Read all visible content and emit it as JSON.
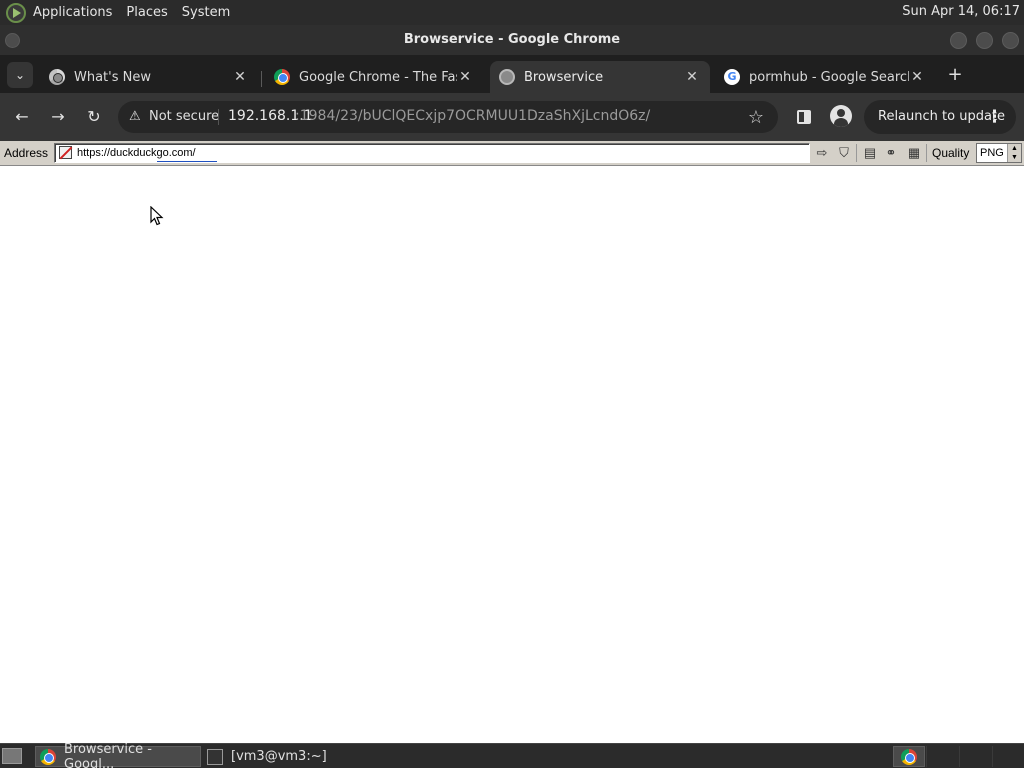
{
  "top_panel": {
    "menus": [
      "Applications",
      "Places",
      "System"
    ],
    "clock": "Sun Apr 14, 06:17"
  },
  "window": {
    "title": "Browservice - Google Chrome"
  },
  "tabs": [
    {
      "title": "What's New",
      "icon": "chrome-mono-icon",
      "active": false
    },
    {
      "title": "Google Chrome - The Fast",
      "icon": "chrome-icon",
      "active": false
    },
    {
      "title": "Browservice",
      "icon": "globe-icon",
      "active": true
    },
    {
      "title": "pormhub - Google Search",
      "icon": "google-icon",
      "active": false
    }
  ],
  "tab_search_icon": "chevron-down-icon",
  "new_tab_icon": "plus-icon",
  "toolbar": {
    "back_icon": "arrow-left-icon",
    "forward_icon": "arrow-right-icon",
    "reload_icon": "reload-icon",
    "security_label": "Not secure",
    "url_host": "192.168.1.1",
    "url_path": ":1984/23/bUClQECxjp7OCRMUU1DzaShXjLcndO6z/",
    "bookmark_icon": "star-icon",
    "relaunch_label": "Relaunch to update"
  },
  "browservice_bar": {
    "address_label": "Address",
    "address_value": "https://duckduckgo.com/",
    "quality_label": "Quality",
    "quality_value": "PNG"
  },
  "taskbar": {
    "tasks": [
      {
        "label": "Browservice - Googl...",
        "active": true
      },
      {
        "label": "[vm3@vm3:~]",
        "active": false
      }
    ]
  }
}
